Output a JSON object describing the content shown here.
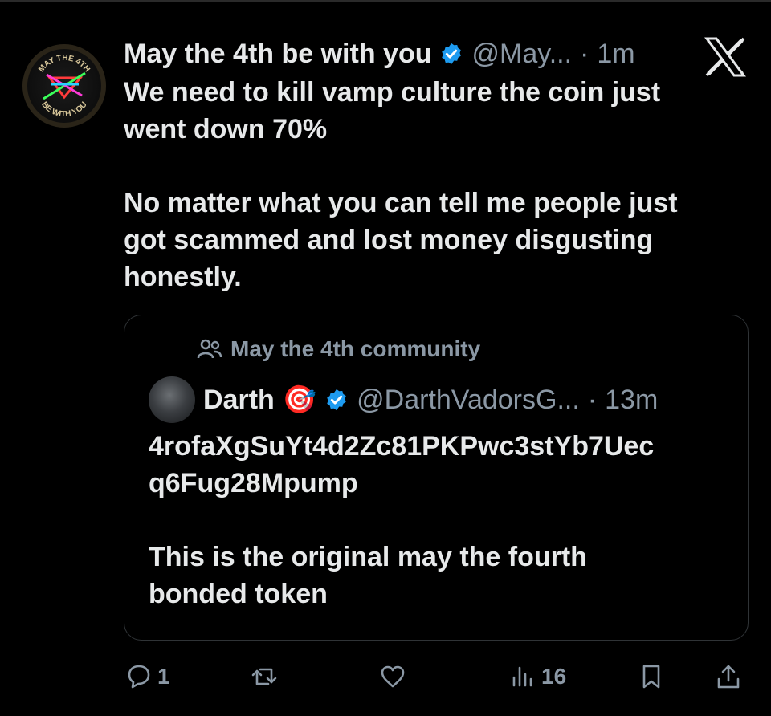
{
  "tweet": {
    "author_name": "May the 4th be with you",
    "handle": "@May...",
    "separator": "·",
    "time": "1m",
    "avatar_text_top": "MAY THE 4TH",
    "avatar_text_bottom": "BE WITH YOU",
    "text_lines": [
      "We need to kill vamp culture the coin just",
      "went down 70%",
      "No matter what you can tell me people just",
      "got scammed and lost money disgusting",
      "honestly."
    ]
  },
  "quote": {
    "community": "May the 4th community",
    "author_name": "Darth",
    "emoji": "🎯",
    "handle": "@DarthVadorsG...",
    "separator": "·",
    "time": "13m",
    "text_lines": [
      "4rofaXgSuYt4d2Zc81PKPwc3stYb7Uec",
      "q6Fug28Mpump",
      "This is the original may the fourth",
      "bonded token"
    ]
  },
  "actions": {
    "reply_count": "1",
    "views_count": "16"
  },
  "colors": {
    "background": "#000000",
    "text": "#e7e9ea",
    "muted": "#8b98a5",
    "verified": "#1d9bf0",
    "border": "#2f3336"
  }
}
